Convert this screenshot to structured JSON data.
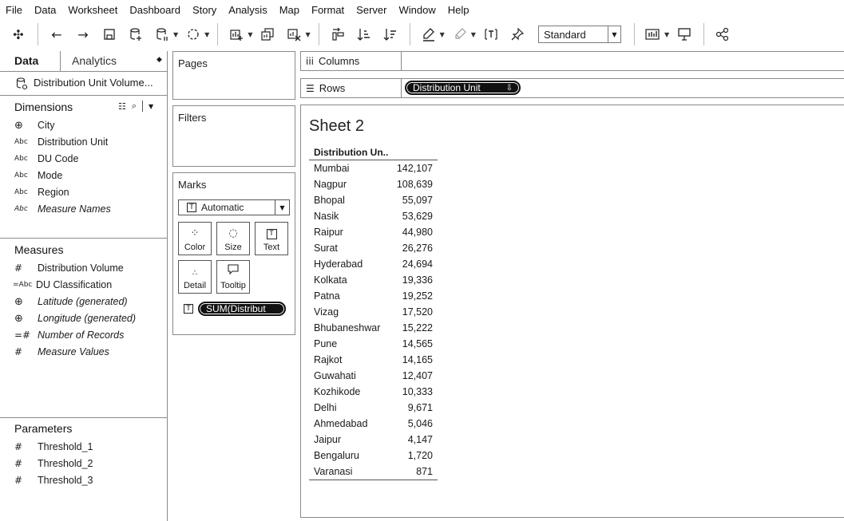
{
  "menu": [
    "File",
    "Data",
    "Worksheet",
    "Dashboard",
    "Story",
    "Analysis",
    "Map",
    "Format",
    "Server",
    "Window",
    "Help"
  ],
  "toolbar": {
    "fit_select": "Standard"
  },
  "left_pane": {
    "tab_data": "Data",
    "tab_analytics": "Analytics",
    "datasource": "Distribution Unit Volume...",
    "dimensions_title": "Dimensions",
    "dimensions": [
      {
        "icon": "Abc-globe",
        "label": "City"
      },
      {
        "icon": "Abc",
        "label": "Distribution Unit"
      },
      {
        "icon": "Abc",
        "label": "DU Code"
      },
      {
        "icon": "Abc",
        "label": "Mode"
      },
      {
        "icon": "Abc",
        "label": "Region"
      },
      {
        "icon": "Abc",
        "label": "Measure Names"
      }
    ],
    "measures_title": "Measures",
    "measures": [
      {
        "icon": "#",
        "label": "Distribution Volume"
      },
      {
        "icon": "=Abc",
        "label": "DU Classification"
      },
      {
        "icon": "globe",
        "label": "Latitude (generated)"
      },
      {
        "icon": "globe",
        "label": "Longitude (generated)"
      },
      {
        "icon": "=#",
        "label": "Number of Records"
      },
      {
        "icon": "#",
        "label": "Measure Values"
      }
    ],
    "parameters_title": "Parameters",
    "parameters": [
      "Threshold_1",
      "Threshold_2",
      "Threshold_3"
    ]
  },
  "cards": {
    "pages": "Pages",
    "filters": "Filters",
    "marks": "Marks",
    "mark_type": "Automatic",
    "color": "Color",
    "size": "Size",
    "text": "Text",
    "detail": "Detail",
    "tooltip": "Tooltip",
    "marks_pill": "SUM(Distribut"
  },
  "shelves": {
    "columns": "Columns",
    "rows": "Rows",
    "rows_pill": "Distribution Unit"
  },
  "sheet": {
    "title": "Sheet 2",
    "header": "Distribution Un..",
    "rows": [
      {
        "city": "Mumbai",
        "value": "142,107"
      },
      {
        "city": "Nagpur",
        "value": "108,639"
      },
      {
        "city": "Bhopal",
        "value": "55,097"
      },
      {
        "city": "Nasik",
        "value": "53,629"
      },
      {
        "city": "Raipur",
        "value": "44,980"
      },
      {
        "city": "Surat",
        "value": "26,276"
      },
      {
        "city": "Hyderabad",
        "value": "24,694"
      },
      {
        "city": "Kolkata",
        "value": "19,336"
      },
      {
        "city": "Patna",
        "value": "19,252"
      },
      {
        "city": "Vizag",
        "value": "17,520"
      },
      {
        "city": "Bhubaneshwar",
        "value": "15,222"
      },
      {
        "city": "Pune",
        "value": "14,565"
      },
      {
        "city": "Rajkot",
        "value": "14,165"
      },
      {
        "city": "Guwahati",
        "value": "12,407"
      },
      {
        "city": "Kozhikode",
        "value": "10,333"
      },
      {
        "city": "Delhi",
        "value": "9,671"
      },
      {
        "city": "Ahmedabad",
        "value": "5,046"
      },
      {
        "city": "Jaipur",
        "value": "4,147"
      },
      {
        "city": "Bengaluru",
        "value": "1,720"
      },
      {
        "city": "Varanasi",
        "value": "871"
      }
    ]
  }
}
